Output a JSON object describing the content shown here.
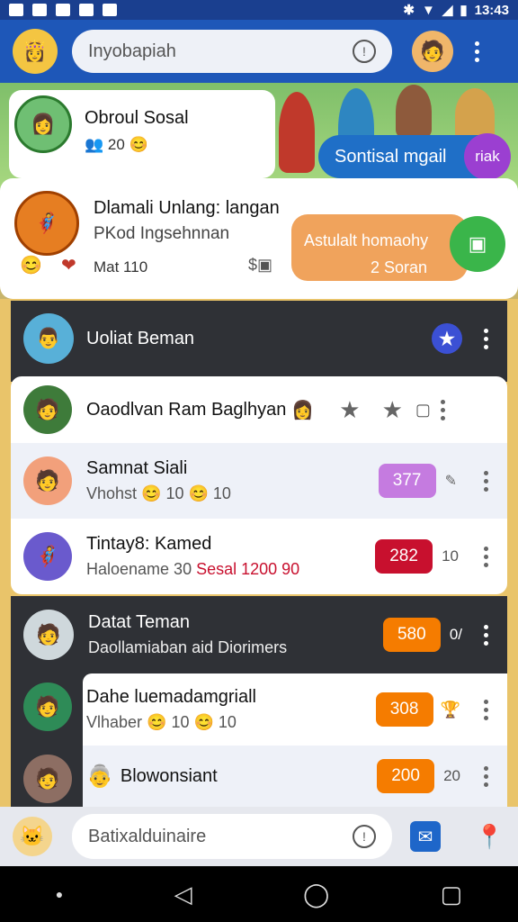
{
  "status": {
    "time": "13:43"
  },
  "header": {
    "search_placeholder": "Inyobapiah"
  },
  "banner": {
    "card1": {
      "title": "Obroul Sosal",
      "sub": "20"
    },
    "pill": {
      "label": "Sontisal mgail",
      "bubble": "riak"
    },
    "card2": {
      "line1": "Dlamali Unlang: langan",
      "line2": "PKod Ingsehnnan",
      "line3": "Mat 110"
    },
    "orange": {
      "line1": "Astulalt homaohy",
      "line2": "2 Soran"
    }
  },
  "section1": {
    "title": "Uoliat Beman",
    "rows": [
      {
        "name": "Oaodlvan Ram Baglhyan"
      },
      {
        "name": "Samnat Siali",
        "sub": "Vhohst 😊 10 😊 10",
        "badge": "377",
        "badge_color": "#c57be0"
      },
      {
        "name": "Tintay8: Kamed",
        "sub_a": "Haloename 30 ",
        "sub_b": "Sesal 1200 90",
        "badge": "282",
        "badge_color": "#c8102e",
        "side": "10"
      }
    ]
  },
  "section2": {
    "title": "Datat Teman",
    "sub": "Daollamiaban aid Diorimers",
    "badge": "580",
    "side": "0/",
    "rows": [
      {
        "name": "Dahe luemadamgriall",
        "sub": "Vlhaber 😊 10 😊 10",
        "badge": "308"
      },
      {
        "name": "Blowonsiant",
        "badge": "200",
        "side": "20"
      }
    ]
  },
  "footer": {
    "search_placeholder": "Batixalduinaire"
  },
  "colors": {
    "primary": "#1e57b8",
    "orange": "#f57c00",
    "dark": "#2f3136",
    "red": "#c8102e",
    "purple": "#c57be0"
  }
}
